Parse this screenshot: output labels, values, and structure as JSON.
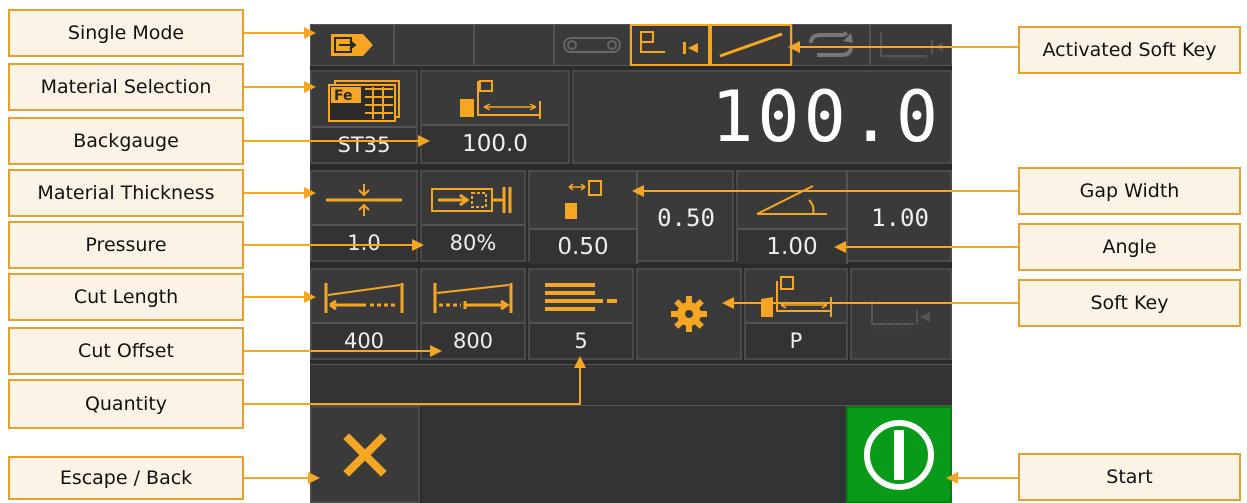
{
  "colors": {
    "accent": "#f5a623",
    "screen_bg": "#2b2b2b",
    "start_green": "#0a9a19",
    "callout_border": "#e8a02d",
    "callout_bg": "#fbf3e6"
  },
  "callouts": {
    "single_mode": "Single Mode",
    "material_selection": "Material Selection",
    "backgauge": "Backgauge",
    "material_thickness": "Material Thickness",
    "pressure": "Pressure",
    "cut_length": "Cut Length",
    "cut_offset": "Cut Offset",
    "quantity": "Quantity",
    "escape_back": "Escape / Back",
    "activated_soft_key": "Activated Soft Key",
    "gap_width": "Gap Width",
    "angle": "Angle",
    "soft_key": "Soft Key",
    "start": "Start"
  },
  "screen": {
    "material_value": "ST35",
    "backgauge_value": "100.0",
    "backgauge_big": "100.0",
    "thickness_value": "1.0",
    "pressure_value": "80%",
    "gap_width_value": "0.50",
    "gap_width_set": "0.50",
    "angle_value": "1.00",
    "angle_set": "1.00",
    "cut_length_value": "400",
    "cut_offset_value": "800",
    "quantity_value": "5",
    "program_value": "P",
    "material_icon_text": "Fe"
  }
}
